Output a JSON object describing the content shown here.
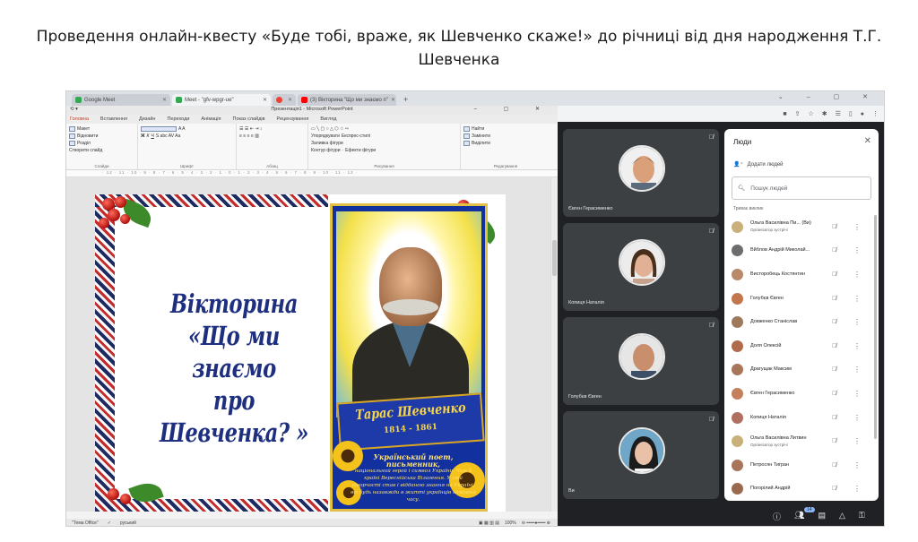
{
  "doc": {
    "title": "Проведення онлайн-квесту «Буде тобі, враже, як Шевченко скаже!» до річниці від дня народження Т.Г. Шевченка"
  },
  "browser": {
    "tabs": [
      {
        "label": "Google Meet",
        "color": "#34a853",
        "active": false
      },
      {
        "label": "Meet - \"gfv-wpgr-ue\"",
        "color": "#34a853",
        "active": true
      },
      {
        "label": "",
        "color": "#ea4335",
        "active": false
      },
      {
        "label": "(3) Вікторина \"Що ми знаємо п\"",
        "color": "#ff0000",
        "active": false
      }
    ],
    "new_tab": "+"
  },
  "ppt": {
    "window_title": "Презентація1 - Microsoft PowerPoint",
    "ribbon_tabs": [
      "Головна",
      "Вставлення",
      "Дизайн",
      "Переходи",
      "Анімація",
      "Показ слайдів",
      "Рецензування",
      "Вигляд"
    ],
    "groups": {
      "slides": {
        "label": "Слайди",
        "create": "Створити слайд",
        "layout": "Макет",
        "reset": "Відновити",
        "section": "Розділ"
      },
      "font": {
        "label": "Шрифт"
      },
      "paragraph": {
        "label": "Абзац"
      },
      "drawing": {
        "label": "Рисування",
        "arrange": "Упорядкувати",
        "styles": "Експрес-стилі",
        "fill": "Заливка фігури",
        "outline": "Контур фігури",
        "effects": "Ефекти фігури"
      },
      "editing": {
        "label": "Редагування",
        "find": "Найти",
        "replace": "Замінити",
        "select": "Виділити"
      }
    },
    "status": {
      "theme": "\"Тема Office\"",
      "lang": "руський",
      "zoom": "100%"
    }
  },
  "slide": {
    "heading_line1": "Вікторина",
    "heading_line2": "«Що ми знаємо",
    "heading_line3": "про Шевченка? »",
    "portrait_name": "Тарас Шевченко",
    "portrait_years": "1814 - 1861",
    "caption_title": "Український поет, письменник,",
    "caption_text": "національний герой і символ України. Чим б країні Вереснійська Вілагення. У свій творчості став і відданою знання на Україні, всі будь назавжди в житті українців кожного часу."
  },
  "meet": {
    "tiles": [
      {
        "name": "Євген Герасименко",
        "skin": "#d9a07a",
        "hair": "#3a2618"
      },
      {
        "name": "Копиця Наталія",
        "skin": "#e2b094",
        "hair": "#4a2e1c"
      },
      {
        "name": "Голубєв Євген",
        "skin": "#c98e6c",
        "hair": "#2e2218"
      },
      {
        "name": "Ви",
        "skin": "#e9c0a8",
        "hair": "#1c1c1c"
      }
    ],
    "panel": {
      "title": "Люди",
      "add_people": "Додати людей",
      "search_placeholder": "Пошук людей",
      "section": "Триває виклик",
      "participants": [
        {
          "name": "Ольга Василівна Пи... (Ви)",
          "role": "Організатор зустрічі",
          "color": "#c9b07a"
        },
        {
          "name": "Вйблов Андрій Миколай...",
          "role": "",
          "color": "#6d6d6d"
        },
        {
          "name": "Висторобець Костянтин",
          "role": "",
          "color": "#b98a6a"
        },
        {
          "name": "Голубєв Євген",
          "role": "",
          "color": "#c2764e"
        },
        {
          "name": "Довженко Станіслав",
          "role": "",
          "color": "#9e7a5c"
        },
        {
          "name": "Доля Олексій",
          "role": "",
          "color": "#b06a4c"
        },
        {
          "name": "Драгущак Максим",
          "role": "",
          "color": "#a8775a"
        },
        {
          "name": "Євген Герасименко",
          "role": "",
          "color": "#c4805c"
        },
        {
          "name": "Копиця Наталія",
          "role": "",
          "color": "#b07060"
        },
        {
          "name": "Ольга Василівна Литвин",
          "role": "Організатор зустрічі",
          "color": "#c9b07a"
        },
        {
          "name": "Петросян Тигран",
          "role": "",
          "color": "#a8745a"
        },
        {
          "name": "Погорілий Андрій",
          "role": "",
          "color": "#9a6a4e"
        }
      ]
    },
    "badge": "14"
  }
}
